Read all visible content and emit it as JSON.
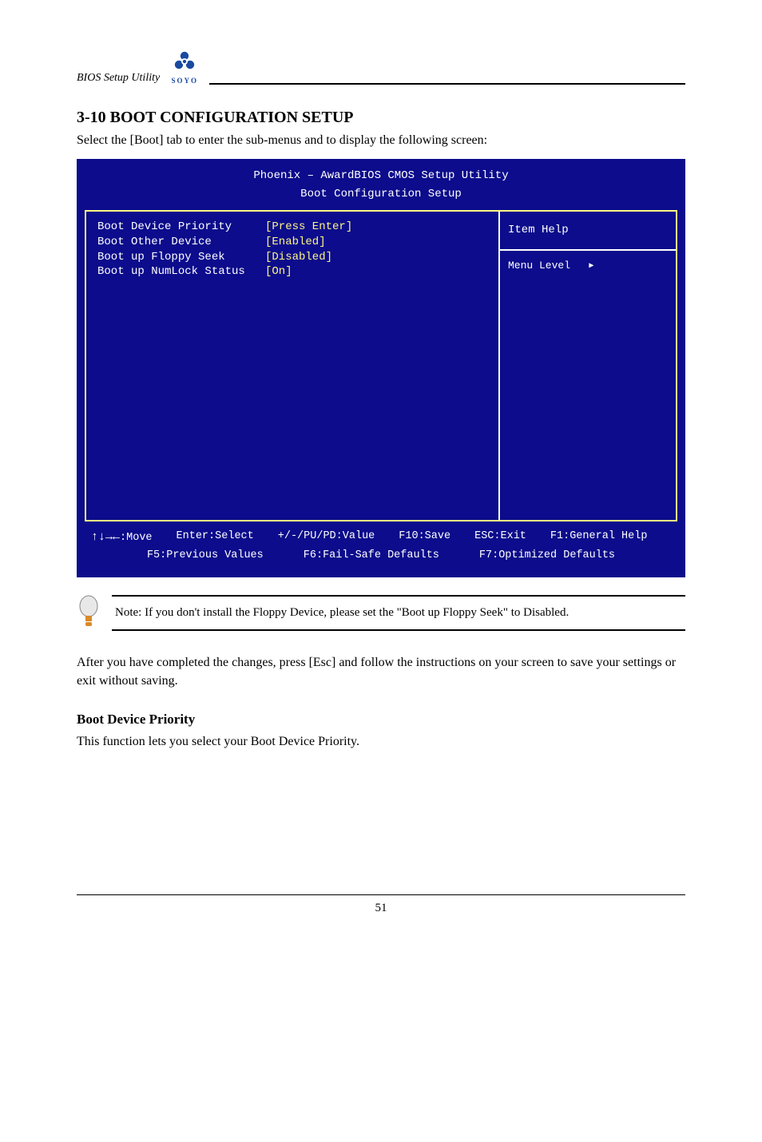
{
  "header": {
    "label": "BIOS Setup Utility",
    "logo_text": "SOYO"
  },
  "section": {
    "title": "3-10 BOOT CONFIGURATION SETUP",
    "intro": "Select the [Boot] tab to enter the sub-menus and to display the following screen:"
  },
  "bios": {
    "title": "Phoenix – AwardBIOS CMOS Setup Utility",
    "subtitle": "Boot Configuration Setup",
    "items": [
      {
        "label": "Boot Device Priority",
        "value": "[Press Enter]"
      },
      {
        "label": "Boot Other Device",
        "value": "[Enabled]"
      },
      {
        "label": "Boot up Floppy Seek",
        "value": "[Disabled]"
      },
      {
        "label": "Boot up NumLock Status",
        "value": "[On]"
      }
    ],
    "help": {
      "header": "Item Help",
      "menu_level": "Menu Level",
      "arrow": "▶"
    },
    "nav": {
      "line1": [
        ":Move",
        "Enter:Select",
        "+/-/PU/PD:Value",
        "F10:Save",
        "ESC:Exit",
        "F1:General Help"
      ],
      "line2": [
        "F5:Previous Values",
        "F6:Fail-Safe Defaults",
        "F7:Optimized Defaults"
      ]
    }
  },
  "note": {
    "text": "Note: If you don't install the Floppy Device, please set the \"Boot up Floppy Seek\" to Disabled."
  },
  "body": {
    "para": "After you have completed the changes, press [Esc] and follow the instructions on your screen to save your settings or exit without saving.",
    "sub_heading": "Boot Device Priority",
    "sub_text": "This function lets you select your Boot Device Priority."
  },
  "page_number": "51"
}
